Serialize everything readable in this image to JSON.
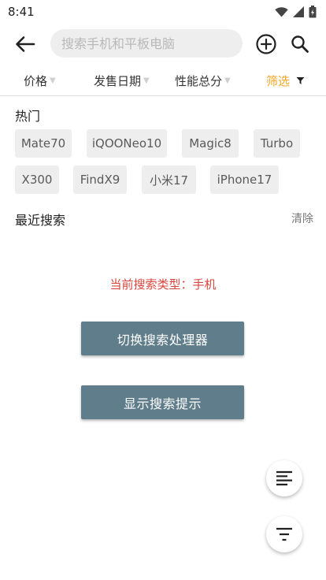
{
  "status_bar": {
    "time": "8:41",
    "icons": [
      "wifi-icon",
      "signal-icon",
      "battery-icon"
    ]
  },
  "app_bar": {
    "back_icon": "arrow-left-icon",
    "search_placeholder": "搜索手机和平板电脑",
    "search_value": "",
    "add_icon": "plus-circle-icon",
    "search_icon": "magnifier-icon"
  },
  "filters": [
    {
      "label": "价格",
      "active": false
    },
    {
      "label": "发售日期",
      "active": false
    },
    {
      "label": "性能总分",
      "active": false
    },
    {
      "label": "筛选",
      "active": true
    }
  ],
  "hot": {
    "title": "热门",
    "chips": [
      "Mate70",
      "iQOONeo10",
      "Magic8",
      "Turbo",
      "X300",
      "FindX9",
      "小米17",
      "iPhone17"
    ]
  },
  "recent": {
    "title": "最近搜索",
    "clear_label": "清除"
  },
  "search_type_text": "当前搜索类型：手机",
  "buttons": {
    "switch_handler": "切换搜索处理器",
    "show_hints": "显示搜索提示"
  },
  "fabs": [
    "align-left-icon",
    "filter-lines-icon"
  ],
  "colors": {
    "accent": "#f5a623",
    "button": "#607d8b",
    "type_text": "#d9453d",
    "chip_bg": "#eeeeee"
  }
}
